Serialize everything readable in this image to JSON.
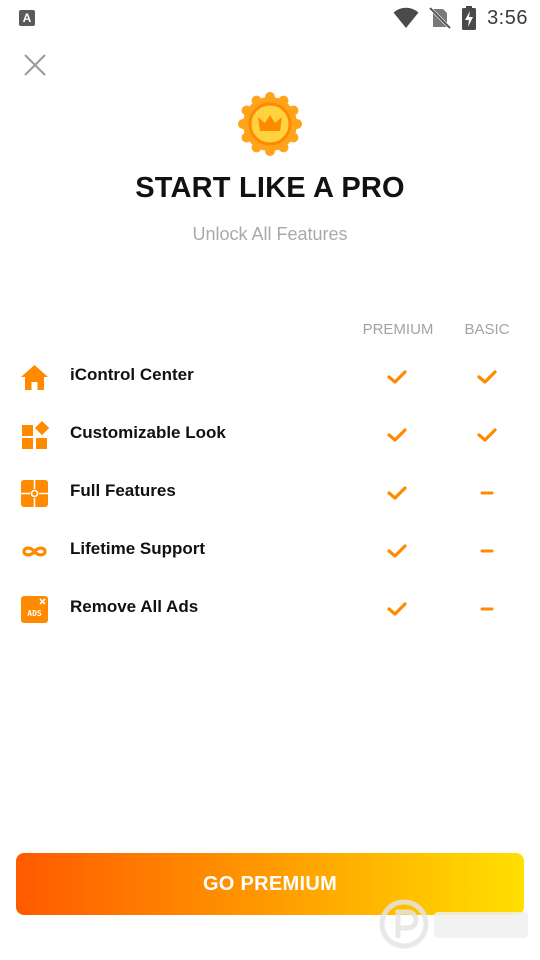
{
  "status_bar": {
    "app_icon_letter": "A",
    "time": "3:56"
  },
  "header": {
    "close_icon": "close-icon",
    "badge_icon": "crown-icon",
    "title": "START LIKE A PRO",
    "subtitle": "Unlock All Features"
  },
  "table": {
    "columns": [
      "PREMIUM",
      "BASIC"
    ],
    "rows": [
      {
        "icon": "home-icon",
        "label": "iControl Center",
        "premium": "check",
        "basic": "check"
      },
      {
        "icon": "widgets-icon",
        "label": "Customizable Look",
        "premium": "check",
        "basic": "check"
      },
      {
        "icon": "puzzle-icon",
        "label": "Full Features",
        "premium": "check",
        "basic": "dash"
      },
      {
        "icon": "infinity-icon",
        "label": "Lifetime Support",
        "premium": "check",
        "basic": "dash"
      },
      {
        "icon": "ads-icon",
        "label": "Remove All Ads",
        "premium": "check",
        "basic": "dash"
      }
    ]
  },
  "cta": {
    "label": "GO PREMIUM"
  },
  "colors": {
    "accent": "#ff8a00",
    "cta_gradient": [
      "#ff5a00",
      "#ffe000"
    ],
    "muted_text": "#a9a9a9"
  }
}
